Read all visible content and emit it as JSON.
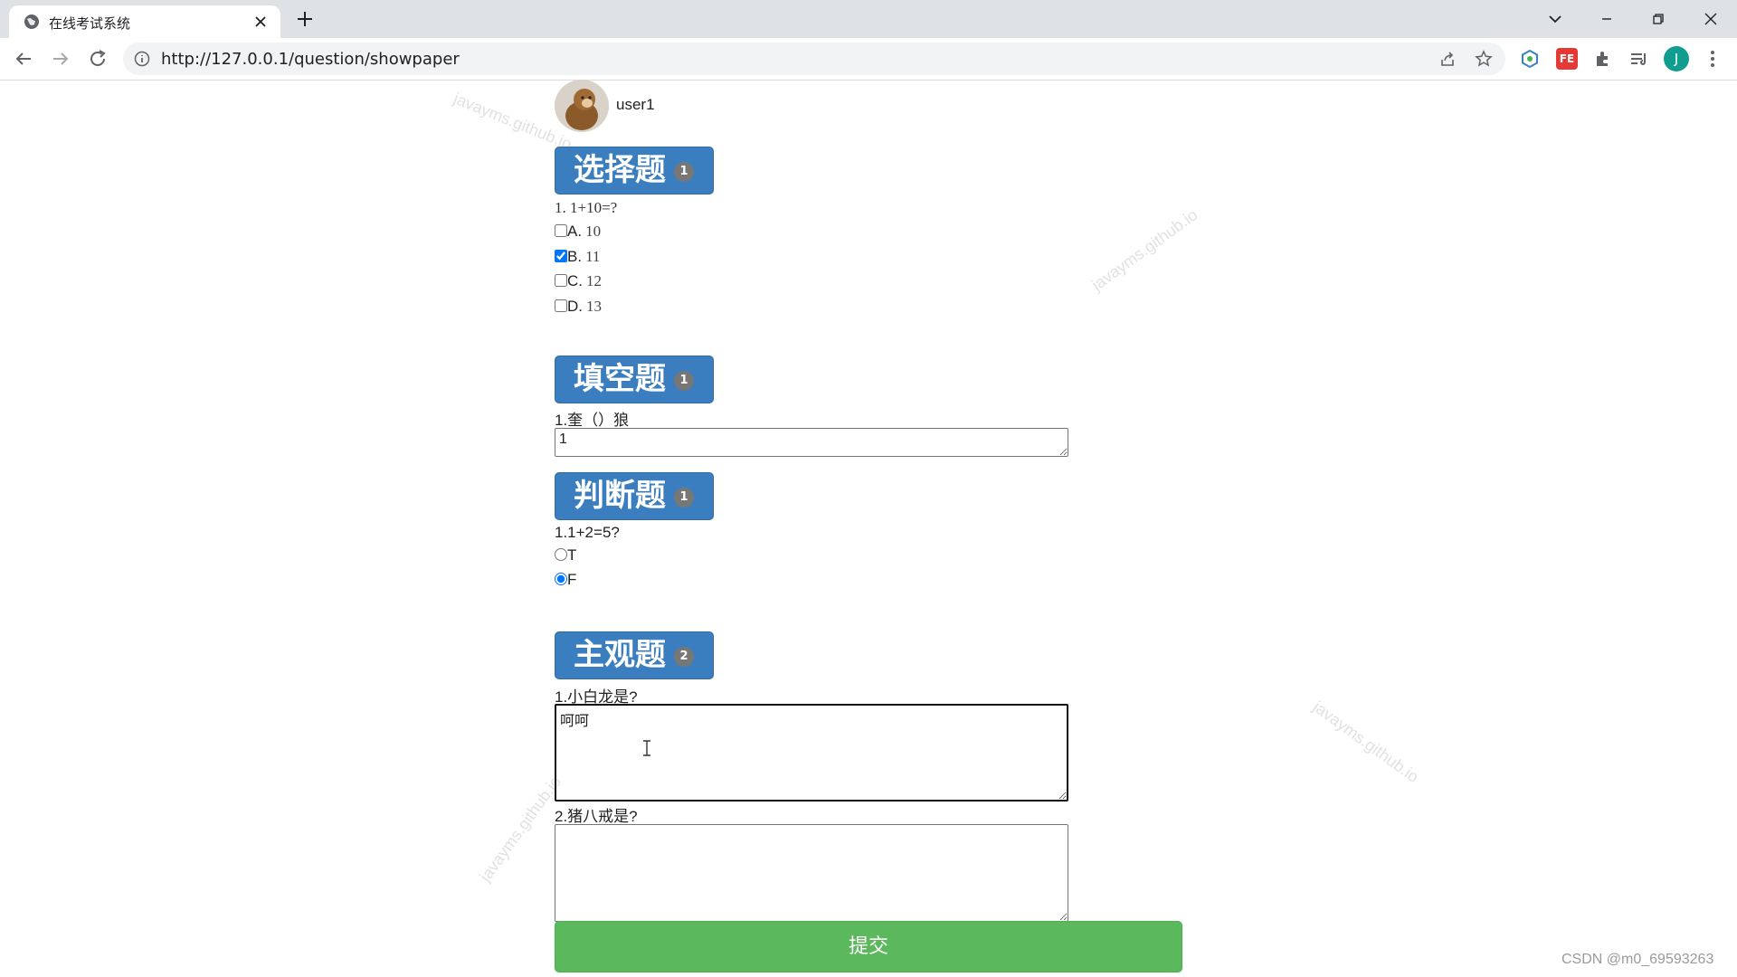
{
  "browser": {
    "tab_title": "在线考试系统",
    "url": "http://127.0.0.1/question/showpaper",
    "profile_initial": "J",
    "ext_fe_label": "FE"
  },
  "user": {
    "name": "user1"
  },
  "sections": {
    "choice": {
      "title": "选择题",
      "count": "1",
      "question": "1. 1+10=?",
      "options": [
        {
          "label": "A.",
          "value": "10",
          "checked": false
        },
        {
          "label": "B.",
          "value": "11",
          "checked": true
        },
        {
          "label": "C.",
          "value": "12",
          "checked": false
        },
        {
          "label": "D.",
          "value": "13",
          "checked": false
        }
      ]
    },
    "fill": {
      "title": "填空题",
      "count": "1",
      "question": "1.奎（）狼",
      "answer": "1"
    },
    "judge": {
      "title": "判断题",
      "count": "1",
      "question": "1.1+2=5?",
      "options": [
        {
          "label": "T",
          "checked": false
        },
        {
          "label": "F",
          "checked": true
        }
      ]
    },
    "subjective": {
      "title": "主观题",
      "count": "2",
      "questions": [
        {
          "text": "1.小白龙是?",
          "answer": "呵呵"
        },
        {
          "text": "2.猪八戒是?",
          "answer": ""
        }
      ]
    }
  },
  "submit_label": "提交",
  "watermark_text": "javayms.github.io",
  "corner_credit": "CSDN @m0_69593263",
  "colors": {
    "section_blue": "#3a7ebf",
    "badge_gray": "#777777",
    "submit_green": "#5cb85c"
  }
}
